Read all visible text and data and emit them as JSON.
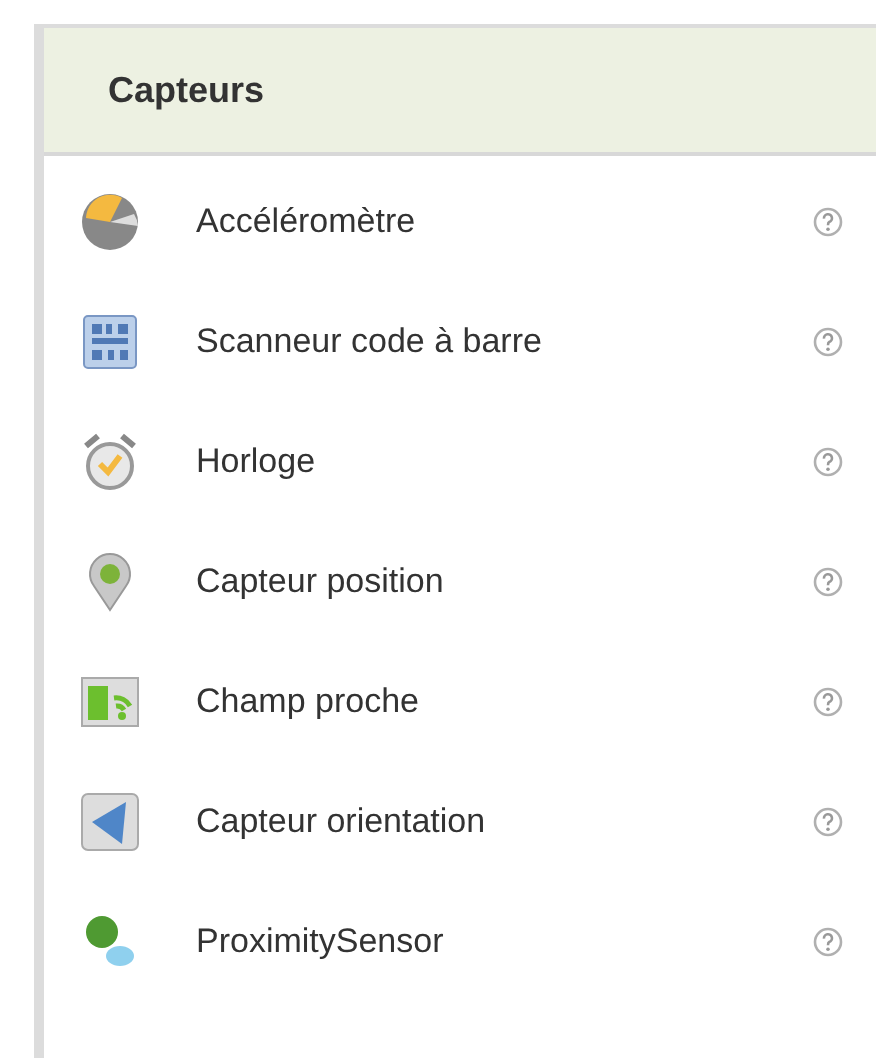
{
  "panel": {
    "title": "Capteurs",
    "items": [
      {
        "label": "Accéléromètre"
      },
      {
        "label": "Scanneur code à barre"
      },
      {
        "label": "Horloge"
      },
      {
        "label": "Capteur position"
      },
      {
        "label": "Champ proche"
      },
      {
        "label": "Capteur orientation"
      },
      {
        "label": "ProximitySensor"
      }
    ]
  }
}
